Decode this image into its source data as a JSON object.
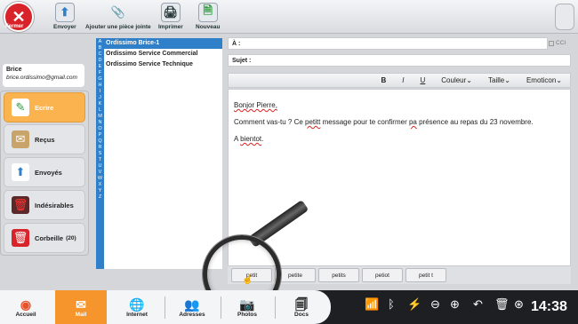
{
  "toolbar": {
    "close_label": "Fermer",
    "close_icon": "close-icon",
    "buttons": [
      {
        "label": "Envoyer",
        "icon": "send-icon"
      },
      {
        "label": "Ajouter une pièce jointe",
        "icon": "paperclip-icon"
      },
      {
        "label": "Imprimer",
        "icon": "printer-icon"
      },
      {
        "label": "Nouveau",
        "icon": "new-document-icon"
      }
    ]
  },
  "user": {
    "name": "Brice",
    "email": "brice.ordissimo@gmail.com"
  },
  "folders": [
    {
      "label": "Ecrire",
      "icon": "compose-icon",
      "selected": true
    },
    {
      "label": "Reçus",
      "icon": "inbox-icon"
    },
    {
      "label": "Envoyés",
      "icon": "sent-icon"
    },
    {
      "label": "Indésirables",
      "icon": "spam-icon"
    },
    {
      "label": "Corbeille",
      "count": "(20)",
      "icon": "trash-icon"
    }
  ],
  "alphabet": [
    "A",
    "B",
    "C",
    "D",
    "E",
    "F",
    "G",
    "H",
    "I",
    "J",
    "K",
    "L",
    "M",
    "N",
    "O",
    "P",
    "Q",
    "R",
    "S",
    "T",
    "U",
    "V",
    "W",
    "X",
    "Y",
    "Z"
  ],
  "contacts": [
    "Ordissimo Brice-1",
    "Ordissimo Service Commercial",
    "Ordissimo Service Technique"
  ],
  "compose": {
    "to_label": "À :",
    "subject_label": "Sujet :",
    "cc_label": "CCI",
    "format": {
      "bold": "B",
      "italic": "I",
      "underline": "U",
      "color": "Couleur",
      "size": "Taille",
      "emoticon": "Emoticon"
    },
    "body": {
      "greeting": "Bonjor Pierre,",
      "line_pre": "Comment vas-tu ? Ce ",
      "word_petitt": "petitt",
      "line_mid": " message pour te confirmer ",
      "word_pa": "pa",
      "line_post": " présence au repas du 23 novembre.",
      "closing_a": "A ",
      "word_bientot": "bientot",
      "closing_end": "."
    }
  },
  "suggestions": [
    "petit",
    "petite",
    "petits",
    "petiot",
    "petit t"
  ],
  "taskbar": {
    "items": [
      {
        "label": "Accueil",
        "icon": "home-icon"
      },
      {
        "label": "Mail",
        "icon": "mail-icon",
        "selected": true
      },
      {
        "label": "Internet",
        "icon": "globe-icon"
      },
      {
        "label": "Adresses",
        "icon": "contacts-icon"
      },
      {
        "label": "Photos",
        "icon": "camera-icon"
      },
      {
        "label": "Docs",
        "icon": "documents-icon"
      }
    ],
    "time": "14:38"
  },
  "colors": {
    "accent": "#f5952b",
    "blue": "#2f7fc9",
    "close_red": "#d9232a"
  }
}
